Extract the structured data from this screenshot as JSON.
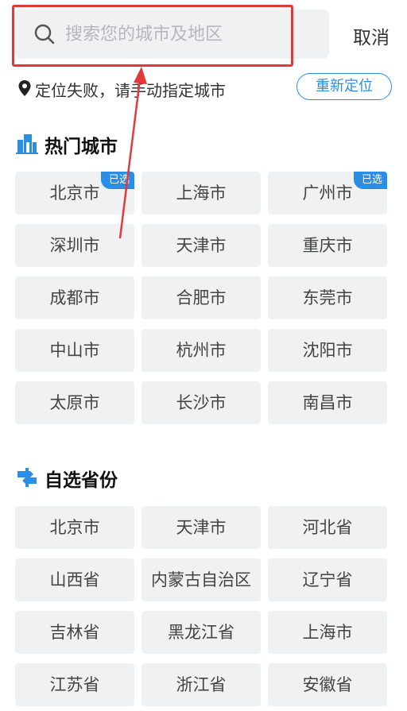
{
  "search": {
    "placeholder": "搜索您的城市及地区",
    "value": ""
  },
  "cancel_label": "取消",
  "location": {
    "status_text": "定位失败，请手动指定城市",
    "relocate_label": "重新定位"
  },
  "hot_cities": {
    "title": "热门城市",
    "items": [
      {
        "label": "北京市",
        "selected": true
      },
      {
        "label": "上海市",
        "selected": false
      },
      {
        "label": "广州市",
        "selected": true
      },
      {
        "label": "深圳市",
        "selected": false
      },
      {
        "label": "天津市",
        "selected": false
      },
      {
        "label": "重庆市",
        "selected": false
      },
      {
        "label": "成都市",
        "selected": false
      },
      {
        "label": "合肥市",
        "selected": false
      },
      {
        "label": "东莞市",
        "selected": false
      },
      {
        "label": "中山市",
        "selected": false
      },
      {
        "label": "杭州市",
        "selected": false
      },
      {
        "label": "沈阳市",
        "selected": false
      },
      {
        "label": "太原市",
        "selected": false
      },
      {
        "label": "长沙市",
        "selected": false
      },
      {
        "label": "南昌市",
        "selected": false
      }
    ]
  },
  "selected_badge": "已选",
  "provinces": {
    "title": "自选省份",
    "items": [
      {
        "label": "北京市"
      },
      {
        "label": "天津市"
      },
      {
        "label": "河北省"
      },
      {
        "label": "山西省"
      },
      {
        "label": "内蒙古自治区"
      },
      {
        "label": "辽宁省"
      },
      {
        "label": "吉林省"
      },
      {
        "label": "黑龙江省"
      },
      {
        "label": "上海市"
      },
      {
        "label": "江苏省"
      },
      {
        "label": "浙江省"
      },
      {
        "label": "安徽省"
      }
    ]
  },
  "colors": {
    "accent": "#2c8ee3",
    "annotation": "#e13838",
    "chip_bg": "#f0f1f3"
  }
}
